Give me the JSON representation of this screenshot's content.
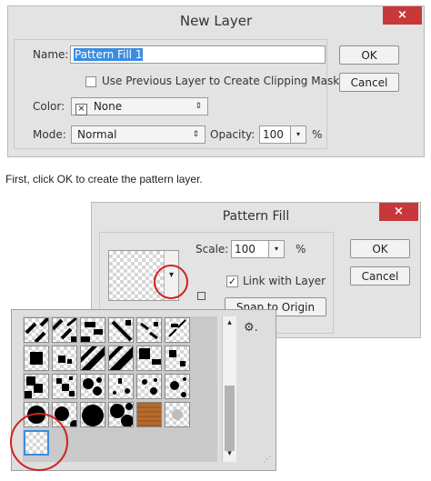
{
  "new_layer": {
    "title": "New Layer",
    "close_glyph": "×",
    "name_label": "Name:",
    "name_value": "Pattern Fill 1",
    "clipping_label": "Use Previous Layer to Create Clipping Mask",
    "color_label": "Color:",
    "color_x": "×",
    "color_value": "None",
    "mode_label": "Mode:",
    "mode_value": "Normal",
    "opacity_label": "Opacity:",
    "opacity_value": "100",
    "opacity_unit": "%",
    "ok_label": "OK",
    "cancel_label": "Cancel",
    "select_arrows": "⇕",
    "spin_arrow": "▾"
  },
  "caption": "First, click OK to create the pattern layer.",
  "pattern_fill": {
    "title": "Pattern Fill",
    "close_glyph": "×",
    "scale_label": "Scale:",
    "scale_value": "100",
    "scale_unit": "%",
    "link_label": "Link with Layer",
    "link_checked": true,
    "snap_label": "Snap to Origin",
    "ok_label": "OK",
    "cancel_label": "Cancel",
    "check_glyph": "✓",
    "spin_arrow": "▾",
    "dropdown_arrow": "▾"
  },
  "picker": {
    "gear_glyph": "⚙.",
    "scroll_up": "▴",
    "scroll_down": "▾",
    "resize_glyph": "⋰",
    "patterns": [
      "diagonal-dashes",
      "diagonal-dashes-dense",
      "diagonal-dashes-bold",
      "diagonal-dashes-right",
      "diagonal-dashes-small",
      "diagonal-dashes-light",
      "big-squares",
      "small-squares",
      "diagonal-stripes-left",
      "diagonal-stripes-right",
      "checker-quarter",
      "sparse-squares",
      "staircase-large",
      "staircase-small",
      "blob-dots",
      "confetti",
      "scattered-dots",
      "large-dots",
      "big-circles",
      "offset-circles",
      "huge-circles",
      "packed-circles",
      "wood-grain",
      "soft-dot",
      "transparent"
    ],
    "selected_index": 24
  },
  "colors": {
    "close_red": "#c8383a",
    "highlight_blue": "#3b8de0",
    "callout_red": "#d22020",
    "wood": "#b86a2c"
  }
}
